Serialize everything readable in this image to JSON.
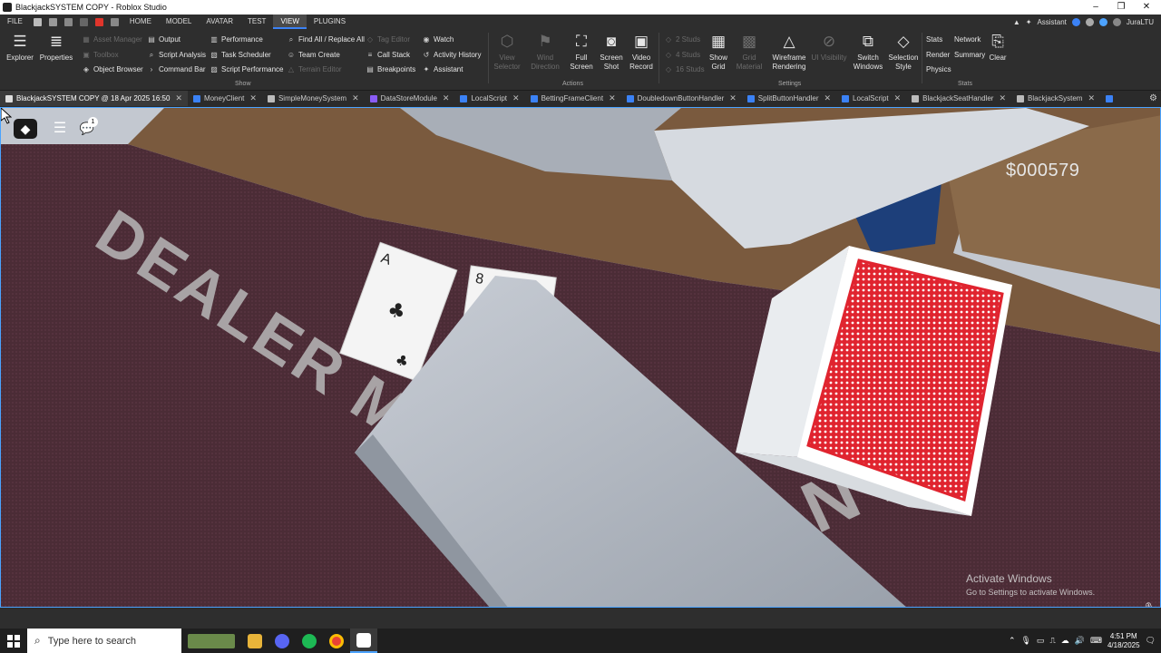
{
  "window": {
    "title": "BlackjackSYSTEM COPY - Roblox Studio"
  },
  "menubar": {
    "items": [
      "FILE",
      "HOME",
      "MODEL",
      "AVATAR",
      "TEST",
      "VIEW",
      "PLUGINS"
    ],
    "assistant_label": "Assistant",
    "user_label": "JuraLTU"
  },
  "ribbon": {
    "explorer": "Explorer",
    "properties": "Properties",
    "show_items": [
      "Asset Manager",
      "Toolbox",
      "Object Browser",
      "Output",
      "Script Analysis",
      "Command Bar",
      "Performance",
      "Task Scheduler",
      "Script Performance",
      "Find All / Replace All",
      "Team Create",
      "Terrain Editor",
      "Tag Editor",
      "Call Stack",
      "Breakpoints",
      "Watch",
      "Activity History",
      "Assistant"
    ],
    "show_group": "Show",
    "view_selector": "View Selector",
    "wind_direction": "Wind Direction",
    "full_screen": "Full Screen",
    "screen_shot": "Screen Shot",
    "video_record": "Video Record",
    "actions_group": "Actions",
    "studs": [
      "2 Studs",
      "4 Studs",
      "16 Studs"
    ],
    "show_grid": "Show Grid",
    "grid_material": "Grid Material",
    "wireframe_rendering": "Wireframe Rendering",
    "ui_visibility": "UI Visibility",
    "switch_windows": "Switch Windows",
    "selection_style": "Selection Style",
    "settings_group": "Settings",
    "stats_items": [
      "Stats",
      "Network",
      "Render",
      "Summary",
      "Physics"
    ],
    "clear": "Clear",
    "stats_group": "Stats"
  },
  "tabs": [
    {
      "label": "BlackjackSYSTEM COPY @ 18 Apr 2025 16:50",
      "active": true
    },
    {
      "label": "MoneyClient"
    },
    {
      "label": "SimpleMoneySystem"
    },
    {
      "label": "DataStoreModule"
    },
    {
      "label": "LocalScript"
    },
    {
      "label": "BettingFrameClient"
    },
    {
      "label": "DoubledownButtonHandler"
    },
    {
      "label": "SplitButtonHandler"
    },
    {
      "label": "LocalScript"
    },
    {
      "label": "BlackjackSeatHandler"
    },
    {
      "label": "BlackjackSystem"
    }
  ],
  "viewport": {
    "money": "$000579",
    "table_text": "DEALER MUST",
    "table_text2": "N 17",
    "card_rank": "A",
    "card_rank2": "8",
    "chat_badge": "1",
    "activate_title": "Activate Windows",
    "activate_sub": "Go to Settings to activate Windows."
  },
  "taskbar": {
    "search_placeholder": "Type here to search",
    "time": "4:51 PM",
    "date": "4/18/2025"
  },
  "colors": {
    "accent": "#3b82f6",
    "felt": "#4a2d36",
    "card_back": "#e0242f"
  }
}
